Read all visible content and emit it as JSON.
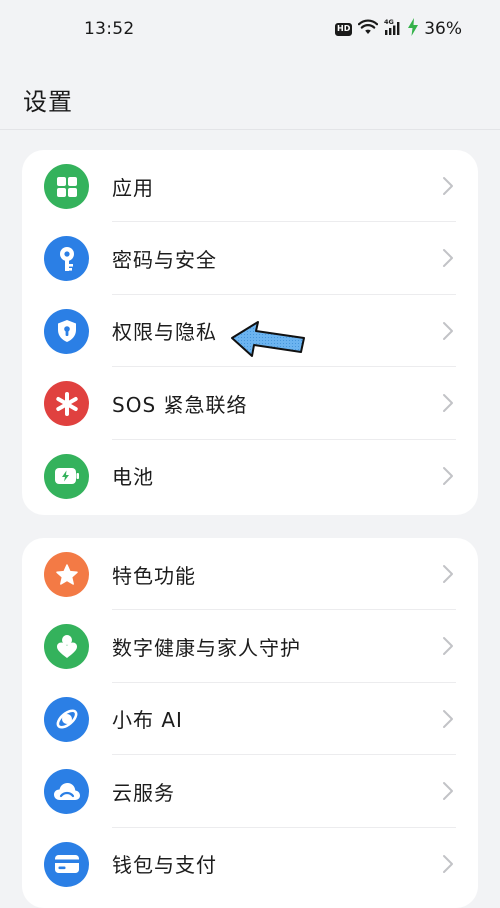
{
  "status": {
    "time": "13:52",
    "hd": "HD",
    "network": "4G",
    "battery": "36%"
  },
  "header": {
    "title": "设置"
  },
  "groups": [
    {
      "items": [
        {
          "label": "应用",
          "icon": "apps-grid-icon",
          "color": "#34b25c"
        },
        {
          "label": "密码与安全",
          "icon": "key-icon",
          "color": "#2b7fe5"
        },
        {
          "label": "权限与隐私",
          "icon": "shield-lock-icon",
          "color": "#2b7fe5"
        },
        {
          "label": "SOS 紧急联络",
          "icon": "asterisk-icon",
          "color": "#e0413f"
        },
        {
          "label": "电池",
          "icon": "battery-icon",
          "color": "#34b25c"
        }
      ]
    },
    {
      "items": [
        {
          "label": "特色功能",
          "icon": "star-icon",
          "color": "#f37a45"
        },
        {
          "label": "数字健康与家人守护",
          "icon": "family-heart-icon",
          "color": "#34b25c"
        },
        {
          "label": "小布 AI",
          "icon": "assistant-icon",
          "color": "#2b7fe5"
        },
        {
          "label": "云服务",
          "icon": "cloud-icon",
          "color": "#2b7fe5"
        },
        {
          "label": "钱包与支付",
          "icon": "wallet-card-icon",
          "color": "#2b7fe5"
        }
      ]
    }
  ],
  "annotation": {
    "icon": "pointer-arrow-icon",
    "color": "#6cb4f0"
  }
}
